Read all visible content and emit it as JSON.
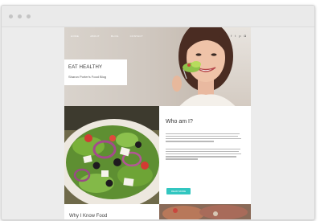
{
  "browser": {
    "dots": [
      "window-dot-1",
      "window-dot-2",
      "window-dot-3"
    ]
  },
  "site": {
    "nav": [
      "HOME",
      "ABOUT",
      "BLOG",
      "CONTACT"
    ],
    "social_icons": [
      {
        "name": "facebook-icon",
        "glyph": "f"
      },
      {
        "name": "twitter-icon",
        "glyph": "t"
      },
      {
        "name": "pinterest-icon",
        "glyph": "p"
      },
      {
        "name": "instagram-icon",
        "glyph": "◘"
      }
    ],
    "brand_title": "EAT HEALTHY",
    "brand_subtitle": "Sharon Porter's Food Blog",
    "about_title": "Who am I?",
    "cta_label": "READ MORE",
    "why_title": "Why I Know Food"
  },
  "colors": {
    "accent": "#32c6c0",
    "window": "#ececec"
  }
}
